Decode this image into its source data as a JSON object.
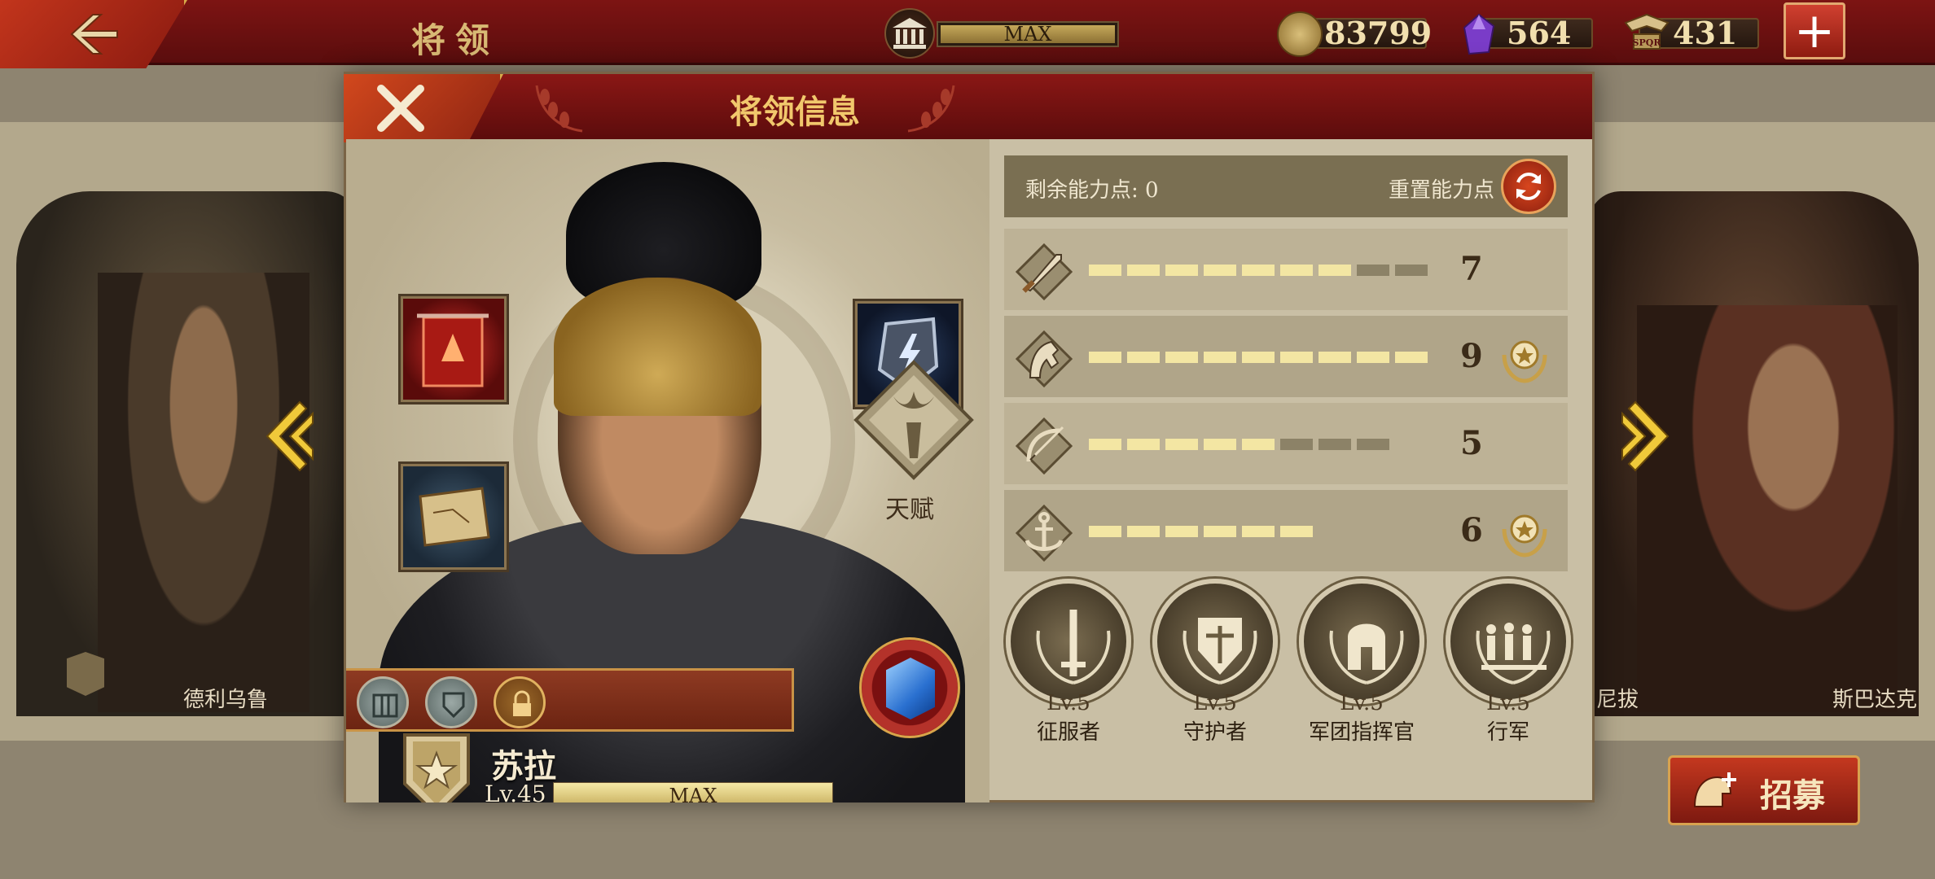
{
  "topbar": {
    "title": "将领",
    "building_level": "MAX",
    "coins": "83799",
    "gems": "564",
    "tokens": "431"
  },
  "background": {
    "left_hero_name": "德利乌鲁",
    "right_hero_name_partial": "尼拔",
    "right_hero_name": "斯巴达克"
  },
  "recruit": {
    "label": "招募"
  },
  "modal": {
    "title": "将领信息",
    "talent_label": "天赋",
    "hero": {
      "name": "苏拉",
      "level": "Lv.45",
      "xp_label": "MAX",
      "xp_fraction": 1.0
    },
    "stats": {
      "points_label": "剩余能力点: 0",
      "reset_label": "重置能力点",
      "rows": [
        {
          "icon": "sword-icon",
          "value": "7",
          "filled": 7,
          "total": 9,
          "badge": false
        },
        {
          "icon": "horse-icon",
          "value": "9",
          "filled": 9,
          "total": 9,
          "badge": true
        },
        {
          "icon": "bow-icon",
          "value": "5",
          "filled": 5,
          "total": 8,
          "badge": false
        },
        {
          "icon": "anchor-icon",
          "value": "6",
          "filled": 6,
          "total": 6,
          "badge": true
        }
      ]
    },
    "skills": [
      {
        "level": "Lv.5",
        "name": "征服者",
        "icon": "sword-laurel-icon"
      },
      {
        "level": "Lv.5",
        "name": "守护者",
        "icon": "shield-laurel-icon"
      },
      {
        "level": "Lv.5",
        "name": "军团指挥官",
        "icon": "helmet-laurel-icon"
      },
      {
        "level": "Lv.5",
        "name": "行军",
        "icon": "marching-soldiers-icon"
      }
    ]
  },
  "colors": {
    "header_red": "#7d1413",
    "accent_gold": "#d7a94a",
    "stat_fill": "#f3e6a3",
    "stat_empty": "#8c8267"
  }
}
